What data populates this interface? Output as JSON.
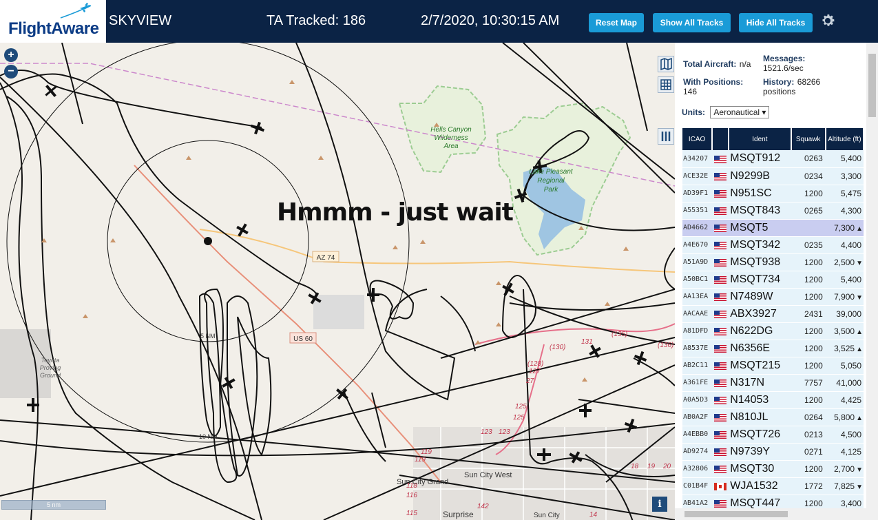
{
  "header": {
    "logo_text": "FlightAware",
    "app_title": "SKYVIEW",
    "ta_tracked": "TA Tracked: 186",
    "clock": "2/7/2020, 10:30:15 AM",
    "btn_reset": "Reset Map",
    "btn_show": "Show All Tracks",
    "btn_hide": "Hide All Tracks",
    "settings_icon": "gear-icon"
  },
  "map": {
    "overlay_text": "Hmmm - just wait",
    "zoom_in": "+",
    "zoom_out": "−",
    "scale_label": "5 nm",
    "ring_labels": [
      "5 NM",
      "10 NM"
    ],
    "place_labels": {
      "hells_canyon": "Hells Canyon Wilderness Area",
      "lake_pleasant": "Lake Pleasant Regional Park",
      "toyota": "Toyota Proving Ground",
      "sun_city_grand": "Sun City Grand",
      "sun_city_west": "Sun City West",
      "surprise": "Surprise",
      "sun_city": "Sun City"
    },
    "road_labels": {
      "az74": "AZ 74",
      "us60": "US 60",
      "r130": "(130)",
      "r131": "131",
      "r135": "(135)",
      "r136": "(136)",
      "r128": "(128)",
      "r127": "127",
      "r27": "27",
      "r125a": "125",
      "r125b": "125",
      "r123a": "123",
      "r123b": "123",
      "r119a": "119",
      "r119b": "119",
      "r118": "118",
      "r116": "116",
      "r115": "115",
      "r142": "142",
      "r19": "19",
      "r20": "20",
      "r14": "14",
      "r18": "18"
    },
    "info_icon": "i"
  },
  "sidebar": {
    "total_aircraft_label": "Total Aircraft:",
    "total_aircraft_value": "n/a",
    "with_positions_label": "With Positions:",
    "with_positions_value": "146",
    "messages_label": "Messages:",
    "messages_value": "1521.6/sec",
    "history_label": "History:",
    "history_value": "68266",
    "history_unit": "positions",
    "units_label": "Units:",
    "units_value": "Aeronautical",
    "columns": [
      "ICAO",
      "",
      "Ident",
      "Squawk",
      "Altitude (ft)"
    ],
    "rows": [
      {
        "icao": "A34207",
        "flag": "us",
        "ident": "MSQT912",
        "squawk": "0263",
        "alt": "5,400",
        "trend": ""
      },
      {
        "icao": "ACE32E",
        "flag": "us",
        "ident": "N9299B",
        "squawk": "0234",
        "alt": "3,300",
        "trend": ""
      },
      {
        "icao": "AD39F1",
        "flag": "us",
        "ident": "N951SC",
        "squawk": "1200",
        "alt": "5,475",
        "trend": ""
      },
      {
        "icao": "A55351",
        "flag": "us",
        "ident": "MSQT843",
        "squawk": "0265",
        "alt": "4,300",
        "trend": ""
      },
      {
        "icao": "AD4662",
        "flag": "us",
        "ident": "MSQT5",
        "squawk": "",
        "alt": "7,300",
        "trend": "▲"
      },
      {
        "icao": "A4E670",
        "flag": "us",
        "ident": "MSQT342",
        "squawk": "0235",
        "alt": "4,400",
        "trend": ""
      },
      {
        "icao": "A51A9D",
        "flag": "us",
        "ident": "MSQT938",
        "squawk": "1200",
        "alt": "2,500",
        "trend": "▼"
      },
      {
        "icao": "A50BC1",
        "flag": "us",
        "ident": "MSQT734",
        "squawk": "1200",
        "alt": "5,400",
        "trend": ""
      },
      {
        "icao": "AA13EA",
        "flag": "us",
        "ident": "N7489W",
        "squawk": "1200",
        "alt": "7,900",
        "trend": "▼"
      },
      {
        "icao": "AACAAE",
        "flag": "us",
        "ident": "ABX3927",
        "squawk": "2431",
        "alt": "39,000",
        "trend": ""
      },
      {
        "icao": "A81DFD",
        "flag": "us",
        "ident": "N622DG",
        "squawk": "1200",
        "alt": "3,500",
        "trend": "▲"
      },
      {
        "icao": "A8537E",
        "flag": "us",
        "ident": "N6356E",
        "squawk": "1200",
        "alt": "3,525",
        "trend": "▲"
      },
      {
        "icao": "AB2C11",
        "flag": "us",
        "ident": "MSQT215",
        "squawk": "1200",
        "alt": "5,050",
        "trend": ""
      },
      {
        "icao": "A361FE",
        "flag": "us",
        "ident": "N317N",
        "squawk": "7757",
        "alt": "41,000",
        "trend": ""
      },
      {
        "icao": "A0A5D3",
        "flag": "us",
        "ident": "N14053",
        "squawk": "1200",
        "alt": "4,425",
        "trend": ""
      },
      {
        "icao": "AB0A2F",
        "flag": "us",
        "ident": "N810JL",
        "squawk": "0264",
        "alt": "5,800",
        "trend": "▲"
      },
      {
        "icao": "A4EBB0",
        "flag": "us",
        "ident": "MSQT726",
        "squawk": "0213",
        "alt": "4,500",
        "trend": ""
      },
      {
        "icao": "AD9274",
        "flag": "us",
        "ident": "N9739Y",
        "squawk": "0271",
        "alt": "4,125",
        "trend": ""
      },
      {
        "icao": "A32806",
        "flag": "us",
        "ident": "MSQT30",
        "squawk": "1200",
        "alt": "2,700",
        "trend": "▼"
      },
      {
        "icao": "C01B4F",
        "flag": "ca",
        "ident": "WJA1532",
        "squawk": "1772",
        "alt": "7,825",
        "trend": "▼"
      },
      {
        "icao": "AB41A2",
        "flag": "us",
        "ident": "MSQT447",
        "squawk": "1200",
        "alt": "3,400",
        "trend": ""
      }
    ],
    "selected_row": 4
  }
}
